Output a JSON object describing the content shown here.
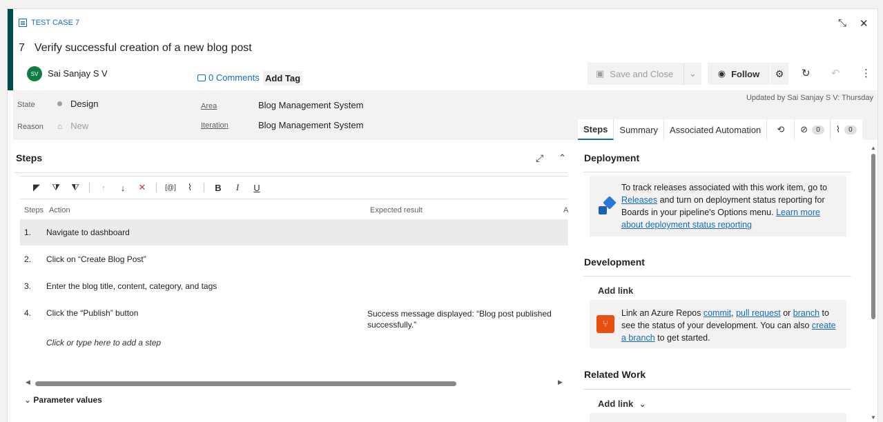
{
  "header": {
    "type_label": "TEST CASE 7",
    "id": "7",
    "title": "Verify successful creation of a new blog post",
    "assignee_initials": "SV",
    "assignee": "Sai Sanjay S V",
    "comments": "0 Comments",
    "add_tag": "Add Tag"
  },
  "toolbar": {
    "save_close": "Save and Close",
    "follow": "Follow",
    "updated": "Updated by Sai Sanjay S V: Thursday"
  },
  "fields": {
    "state_label": "State",
    "state_value": "Design",
    "reason_label": "Reason",
    "reason_value": "New",
    "area_label": "Area",
    "area_value": "Blog Management System",
    "iteration_label": "Iteration",
    "iteration_value": "Blog Management System"
  },
  "tabs": {
    "steps": "Steps",
    "summary": "Summary",
    "automation": "Associated Automation",
    "links_count": "0",
    "attach_count": "0"
  },
  "steps": {
    "title": "Steps",
    "col_steps": "Steps",
    "col_action": "Action",
    "col_expected": "Expected result",
    "col_extra": "A",
    "rows": [
      {
        "num": "1.",
        "action": "Navigate to dashboard",
        "expected": ""
      },
      {
        "num": "2.",
        "action": "Click on “Create Blog Post”",
        "expected": ""
      },
      {
        "num": "3.",
        "action": "Enter the blog title, content, category, and tags",
        "expected": ""
      },
      {
        "num": "4.",
        "action": "Click the “Publish” button",
        "expected": "Success message displayed: “Blog post published successfully.”"
      }
    ],
    "add_step": "Click or type here to add a step",
    "parameter_values": "Parameter values"
  },
  "deployment": {
    "title": "Deployment",
    "text1": "To track releases associated with this work item, go to",
    "releases": "Releases",
    "text2": "and turn on deployment status reporting for Boards in your pipeline's Options menu.",
    "learn_more": "Learn more about deployment status reporting"
  },
  "development": {
    "title": "Development",
    "add_link": "Add link",
    "text1": "Link an Azure Repos",
    "commit": "commit",
    "pull_request": "pull request",
    "or": "or",
    "branch": "branch",
    "text2": "to see the status of your development. You can also",
    "create_branch": "create a branch",
    "text3": "to get started."
  },
  "related": {
    "title": "Related Work",
    "add_link": "Add link"
  }
}
